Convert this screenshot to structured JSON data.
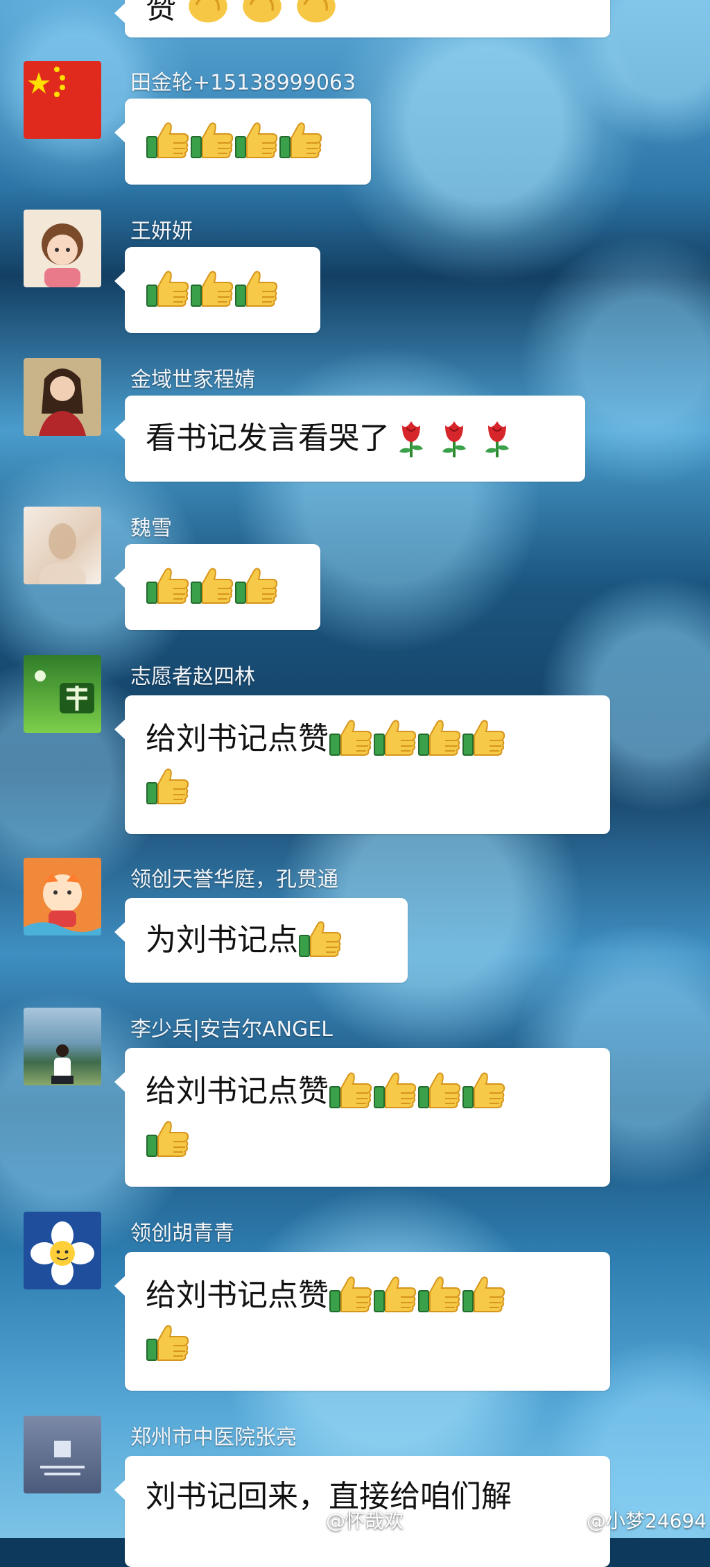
{
  "top_partial_text": "赞",
  "messages": [
    {
      "name": "田金轮+15138999063",
      "avatar": "china-flag-avatar",
      "text": "",
      "line2": ""
    },
    {
      "name": "王妍妍",
      "avatar": "cartoon-girl-avatar",
      "text": "",
      "line2": ""
    },
    {
      "name": "金域世家程婧",
      "avatar": "woman-portrait-avatar",
      "text": "看书记发言看哭了",
      "line2": ""
    },
    {
      "name": "魏雪",
      "avatar": "blurred-photo-avatar",
      "text": "",
      "line2": ""
    },
    {
      "name": "志愿者赵四林",
      "avatar": "green-landscape-avatar",
      "text": "给刘书记点赞",
      "line2": ""
    },
    {
      "name": "领创天誉华庭，孔贯通",
      "avatar": "tiger-cartoon-avatar",
      "text": "为刘书记点",
      "line2": ""
    },
    {
      "name": "李少兵|安吉尔ANGEL",
      "avatar": "lakeside-photo-avatar",
      "text": "给刘书记点赞",
      "line2": ""
    },
    {
      "name": "领创胡青青",
      "avatar": "flower-cartoon-avatar",
      "text": "给刘书记点赞",
      "line2": ""
    },
    {
      "name": "郑州市中医院张亮",
      "avatar": "text-card-avatar",
      "text": "刘书记回来，直接给咱们解",
      "line2": ""
    }
  ],
  "watermarks": [
    "@怀哉欢",
    "@小梦24694"
  ],
  "icons": {
    "thumb": "thumbs-up-icon",
    "rose": "rose-icon",
    "clap": "clap-icon"
  },
  "colors": {
    "bubble": "#ffffff",
    "name": "#f2f6fb",
    "background": "#1b5680"
  }
}
